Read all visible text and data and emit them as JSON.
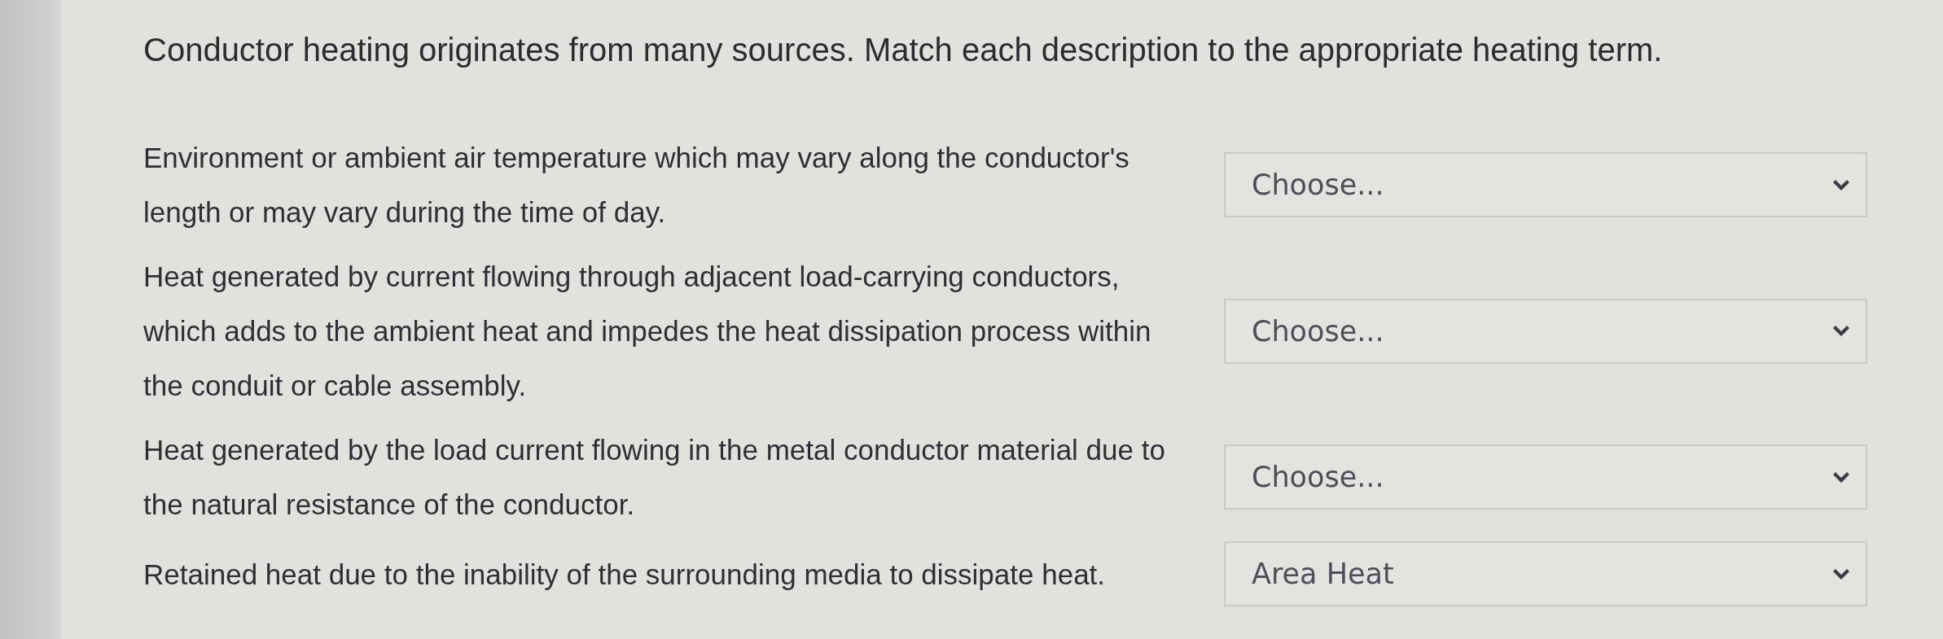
{
  "question": "Conductor heating originates from many sources. Match each description to the appropriate heating term.",
  "items": [
    {
      "description": "Environment or ambient air temperature which may vary along the conductor's length or may vary during the time of day.",
      "value": "Choose..."
    },
    {
      "description": "Heat generated by current flowing through adjacent load-carrying conductors, which adds to the ambient heat and impedes the heat dissipation process within the conduit or cable assembly.",
      "value": "Choose..."
    },
    {
      "description": "Heat generated by the load current flowing in the metal conductor material due to the natural resistance of the conductor.",
      "value": "Choose..."
    },
    {
      "description": "Retained heat due to the inability of the surrounding media to dissipate heat.",
      "value": "Area Heat"
    }
  ]
}
